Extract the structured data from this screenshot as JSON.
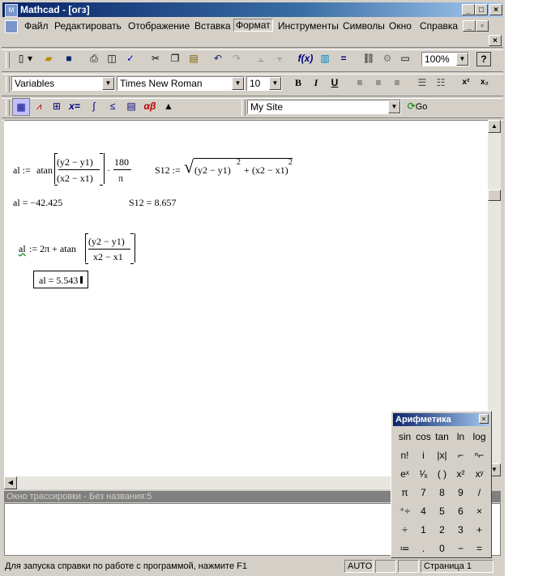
{
  "window": {
    "title": "Mathcad - [огз]",
    "app_icon": "mathcad-icon"
  },
  "menu": [
    "Файл",
    "Редактировать",
    "Отображение",
    "Вставка",
    "Формат",
    "Инструменты",
    "Символы",
    "Окно",
    "Справка"
  ],
  "formatting": {
    "style": "Variables",
    "font": "Times New Roman",
    "size": "10"
  },
  "zoom": "100%",
  "resources": {
    "site": "My Site",
    "go_label": "Go"
  },
  "document": {
    "expr1_lhs": "al :=",
    "expr1_func": "atan",
    "expr1_num": "(y2 − y1)",
    "expr1_den": "(x2 − x1)",
    "expr1_mult": "·",
    "expr1_frac_num": "180",
    "expr1_frac_den": "π",
    "expr2_lhs": "S12 :=",
    "expr2_rad_a": "(y2 − y1)",
    "expr2_exp_a": "2",
    "expr2_plus": "+",
    "expr2_rad_b": "(x2 − x1)",
    "expr2_exp_b": "2",
    "result1": "al = −42.425",
    "result2": "S12 = 8.657",
    "expr3_lhs": "al",
    "expr3_assign": ":= 2π + atan",
    "expr3_num": "(y2 − y1)",
    "expr3_den": "x2 − x1",
    "result3": "al = 5.543"
  },
  "trace_window": {
    "title": "Окно трассировки - Без названия:5"
  },
  "status": {
    "help_text": "Для запуска справки по работе с программой, нажмите F1",
    "mode": "AUTO",
    "page": "Страница 1"
  },
  "palette": {
    "title": "Арифметика",
    "keys": [
      "sin",
      "cos",
      "tan",
      "ln",
      "log",
      "n!",
      "i",
      "|x|",
      "⌐",
      "ⁿ⌐",
      "eˣ",
      "¹⁄ₓ",
      "( )",
      "x²",
      "xʸ",
      "π",
      "7",
      "8",
      "9",
      "/",
      "⁺÷",
      "4",
      "5",
      "6",
      "×",
      "÷",
      "1",
      "2",
      "3",
      "+",
      "≔",
      ".",
      "0",
      "−",
      "="
    ]
  }
}
